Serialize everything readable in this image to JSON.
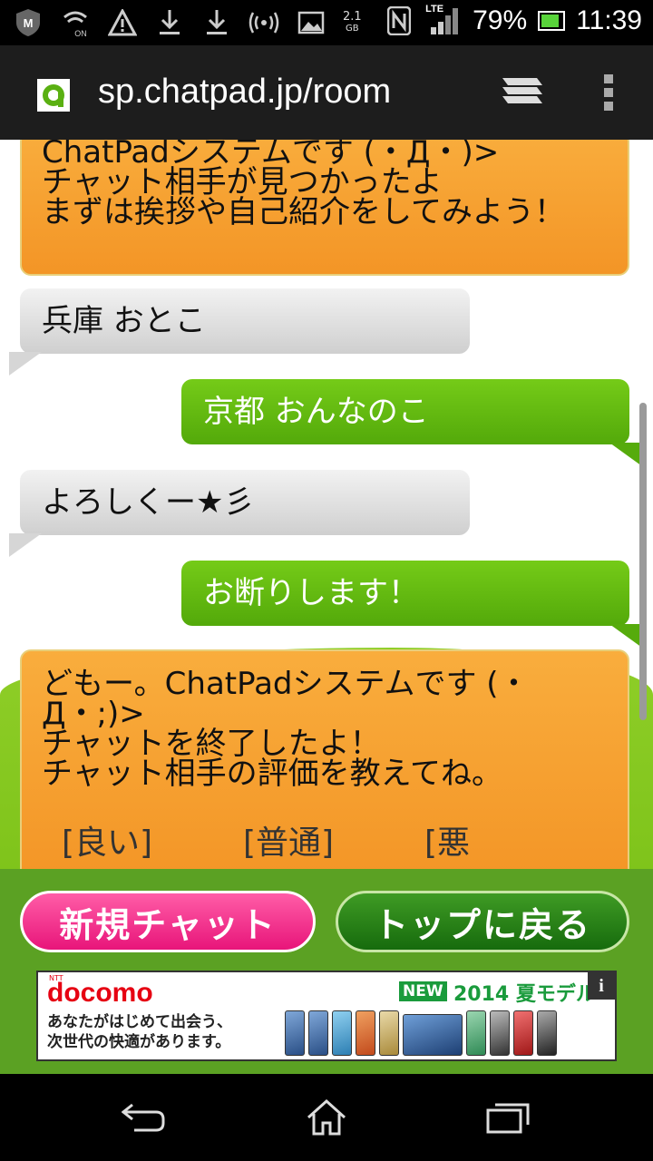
{
  "status_bar": {
    "storage_text": "2.1",
    "storage_unit": "GB",
    "network": "LTE",
    "battery": "79%",
    "time": "11:39"
  },
  "browser": {
    "url": "sp.chatpad.jp/room"
  },
  "chat": {
    "system_message_1": "ChatPadシステムです (・Д・)>\nチャット相手が見つかったよ\nまずは挨拶や自己紹介をしてみよう！",
    "messages": [
      {
        "side": "left",
        "text": "兵庫 おとこ"
      },
      {
        "side": "right",
        "text": "京都 おんなのこ"
      },
      {
        "side": "left",
        "text": "よろしくー★彡"
      },
      {
        "side": "right",
        "text": "お断りします！"
      }
    ],
    "system_message_2": "どもー。ChatPadシステムです (・Д・;)>\nチャットを終了したよ！\nチャット相手の評価を教えてね。",
    "ratings": [
      "[良い]",
      "[普通]",
      "[悪"
    ]
  },
  "buttons": {
    "new_chat": "新規チャット",
    "back_to_top": "トップに戻る"
  },
  "ad": {
    "brand_small": "NTT",
    "brand": "docomo",
    "badge": "NEW",
    "title": "2014 夏モデル",
    "copy": "あなたがはじめて出会う、\n次世代の快適があります。",
    "info": "i"
  },
  "colors": {
    "system_bubble": "#f39526",
    "outgoing_bubble": "#5ab012",
    "incoming_bubble": "#e0e0e0",
    "new_chat_button": "#f0288a",
    "top_button": "#2b8318"
  }
}
